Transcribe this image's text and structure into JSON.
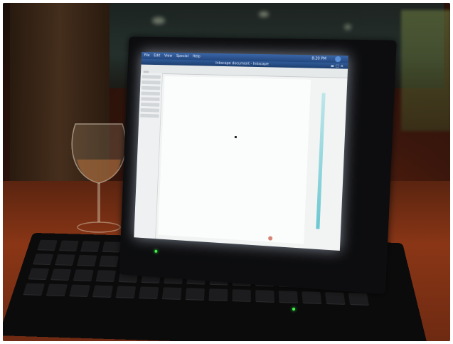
{
  "screen": {
    "panel": {
      "menus": [
        "File",
        "Edit",
        "View",
        "Special",
        "Help"
      ],
      "clock": "8:20 PM"
    },
    "window_title": "Inkscape document - Inkscape"
  },
  "colors": {
    "table": "#8a3616",
    "screen_glow": "#f2f4f4",
    "led": "#3cff48",
    "panel_blue": "#23477f"
  },
  "icons": {
    "tray": "network-icon",
    "status": "record-icon"
  }
}
